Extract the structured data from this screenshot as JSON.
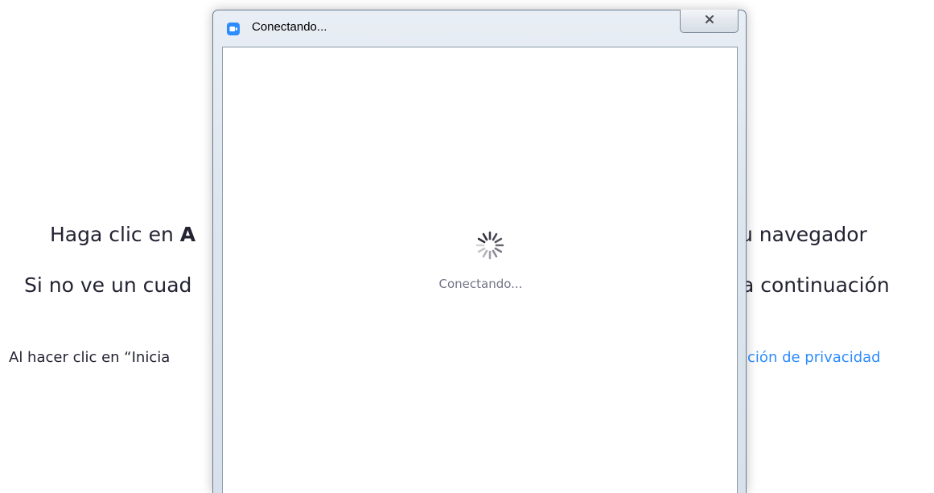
{
  "background_page": {
    "line1_left_prefix": "Haga clic en ",
    "line1_left_bold": "A",
    "line1_right": "u navegador",
    "line2_left": "Si no ve un cuad",
    "line2_right": "a continuación",
    "line3_left": "Al hacer clic en “Inicia",
    "line3_right_link": "ación de privacidad"
  },
  "dialog": {
    "title": "Conectando...",
    "close_glyph": "☒",
    "status": "Conectando...",
    "icons": {
      "app": "zoom-camera-icon",
      "close": "close-icon",
      "spinner": "loading-spinner-icon"
    }
  },
  "colors": {
    "accent": "#2D8CFF",
    "text": "#232333",
    "status_text": "#747487"
  }
}
